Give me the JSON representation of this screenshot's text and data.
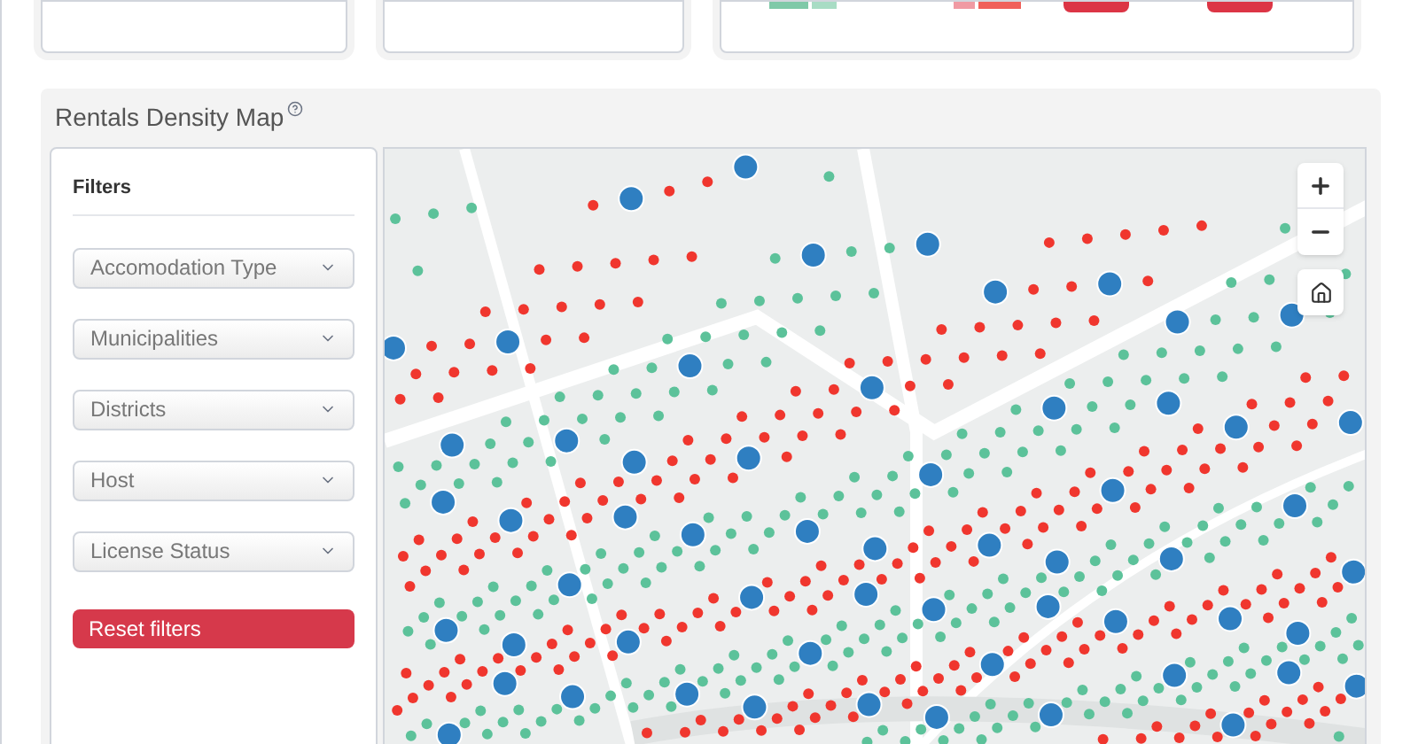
{
  "section": {
    "title": "Rentals Density Map"
  },
  "filters": {
    "heading": "Filters",
    "selects": [
      {
        "placeholder": "Accomodation Type"
      },
      {
        "placeholder": "Municipalities"
      },
      {
        "placeholder": "Districts"
      },
      {
        "placeholder": "Host"
      },
      {
        "placeholder": "License Status"
      }
    ],
    "reset_button": "Reset filters"
  }
}
